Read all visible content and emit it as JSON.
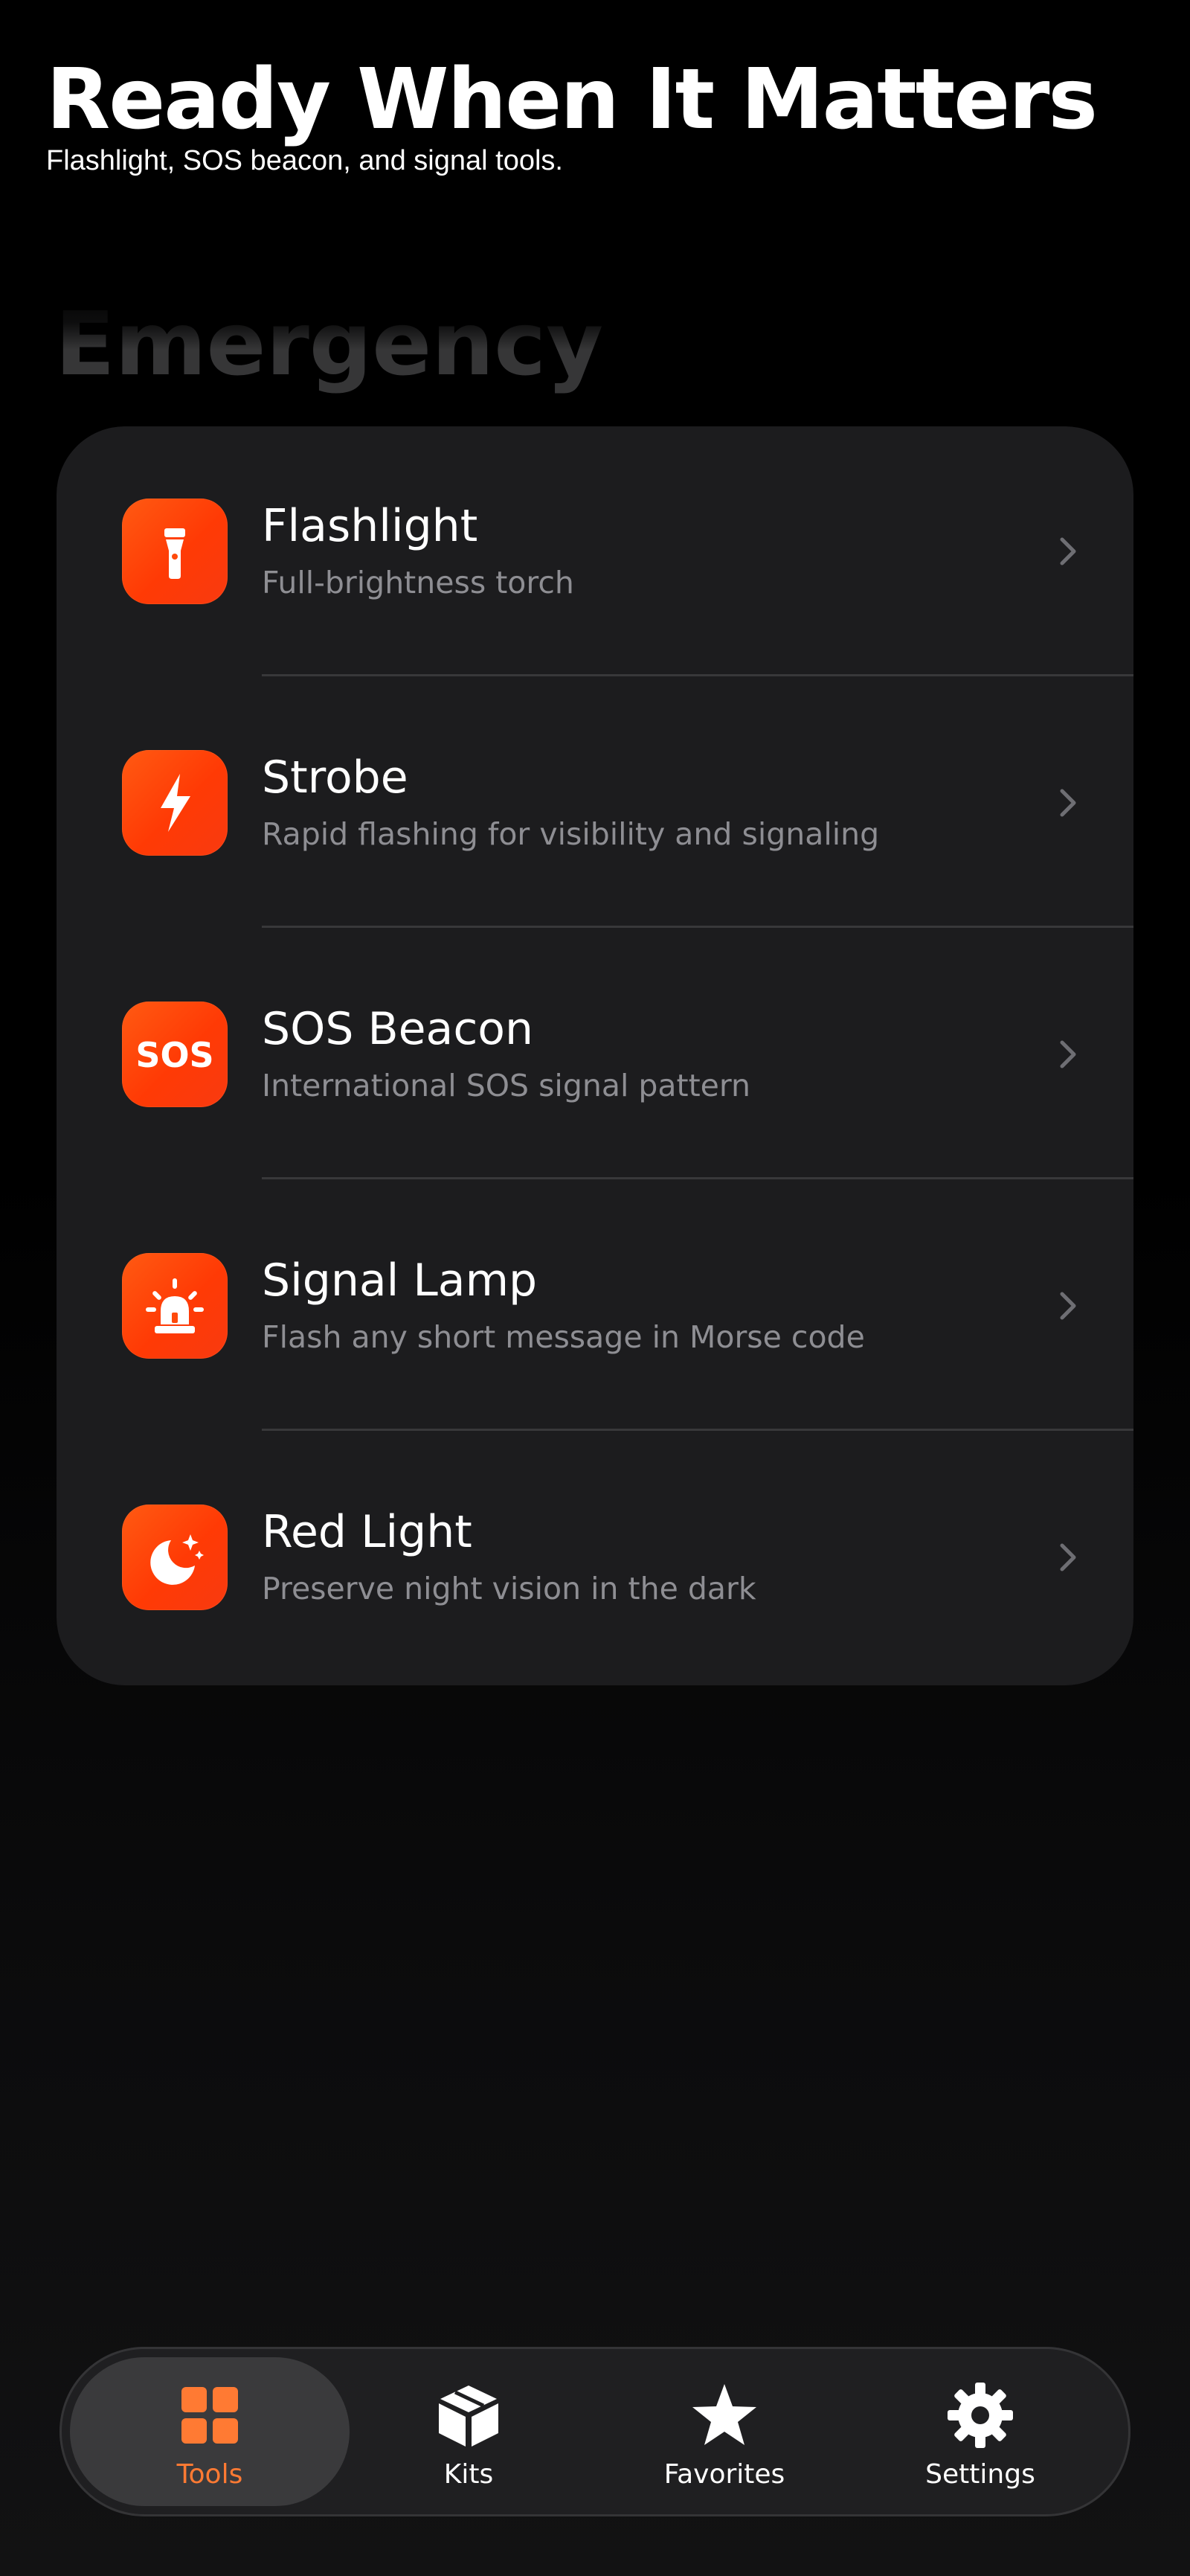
{
  "header": {
    "title": "Ready When It Matters",
    "subtitle": "Flashlight, SOS beacon, and signal tools."
  },
  "section": {
    "title": "Emergency"
  },
  "tools": [
    {
      "title": "Flashlight",
      "subtitle": "Full-brightness torch",
      "icon": "flashlight-icon"
    },
    {
      "title": "Strobe",
      "subtitle": "Rapid flashing for visibility and signaling",
      "icon": "bolt-icon"
    },
    {
      "title": "SOS Beacon",
      "subtitle": "International SOS signal pattern",
      "icon": "sos-icon",
      "icon_text": "SOS"
    },
    {
      "title": "Signal Lamp",
      "subtitle": "Flash any short message in Morse code",
      "icon": "alarm-light-icon"
    },
    {
      "title": "Red Light",
      "subtitle": "Preserve night vision in the dark",
      "icon": "moon-stars-icon"
    }
  ],
  "tabbar": {
    "items": [
      {
        "label": "Tools",
        "icon": "grid-icon",
        "active": true
      },
      {
        "label": "Kits",
        "icon": "box-icon",
        "active": false
      },
      {
        "label": "Favorites",
        "icon": "star-icon",
        "active": false
      },
      {
        "label": "Settings",
        "icon": "gear-icon",
        "active": false
      }
    ]
  },
  "colors": {
    "accent": "#ff7a33",
    "icon_gradient_start": "#ff5a12",
    "icon_gradient_end": "#f83a10",
    "card_background": "#1c1c1e",
    "secondary_text": "#8e8e93"
  }
}
